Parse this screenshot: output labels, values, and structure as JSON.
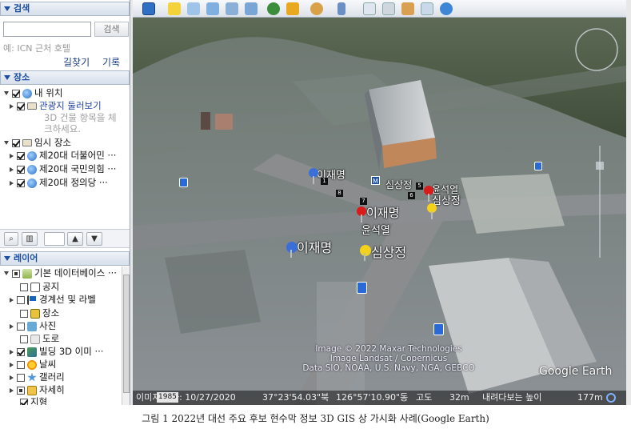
{
  "search": {
    "header": "검색",
    "button_label": "검색",
    "hint": "예: ICN 근처 호텔",
    "directions_link": "길찾기",
    "history_link": "기록"
  },
  "places": {
    "header": "장소",
    "items": [
      {
        "label": "내 위치"
      },
      {
        "label": "관광지 둘러보기"
      },
      {
        "label": "3D 건물 항목을 체"
      },
      {
        "label": "크하세요."
      },
      {
        "label": "임시 장소"
      },
      {
        "label": "제20대 더불어민 ···"
      },
      {
        "label": "제20대 국민의힘 ···"
      },
      {
        "label": "제20대 정의당 ···"
      }
    ]
  },
  "layers": {
    "header": "레이어",
    "items": [
      {
        "label": "기본 데이터베이스 ···"
      },
      {
        "label": "공지"
      },
      {
        "label": "경계선 및 라벨"
      },
      {
        "label": "장소"
      },
      {
        "label": "사진"
      },
      {
        "label": "도로"
      },
      {
        "label": "빌딩 3D 이미 ···"
      },
      {
        "label": "날씨"
      },
      {
        "label": "갤러리"
      },
      {
        "label": "자세히"
      },
      {
        "label": "지형"
      }
    ]
  },
  "map": {
    "labels": {
      "lee_small": "이재명",
      "lee_mid": "이재명",
      "lee_big": "이재명",
      "sim_top": "심상정",
      "yoon_top": "윤석열",
      "sim_mid": "심상정",
      "yoon_mid": "윤석열",
      "sim_big": "심상정"
    },
    "badges": [
      "1",
      "8",
      "7",
      "5",
      "6",
      "M"
    ],
    "attribution": [
      "Image © 2022 Maxar Technologies",
      "Image Landsat / Copernicus",
      "Data SIO, NOAA, U.S. Navy, NGA, GEBCO"
    ],
    "logo": "Google Earth"
  },
  "status": {
    "date": "이미지 날짜: 10/27/2020",
    "year": "1985",
    "lat": "37°23'54.03\"북",
    "lon": "126°57'10.90\"동",
    "elev_label": "고도",
    "elev": "32m",
    "eye_label": "내려다보는 높이",
    "eye": "177m"
  },
  "caption": "그림 1 2022년 대선 주요 후보 현수막 정보 3D GIS 상 가시화 사례(Google Earth)",
  "colors": {
    "accent": "#1b4ea0",
    "pin_red": "#d81b1b",
    "pin_blue": "#3a6fd8",
    "pin_yellow": "#f2d21b"
  }
}
